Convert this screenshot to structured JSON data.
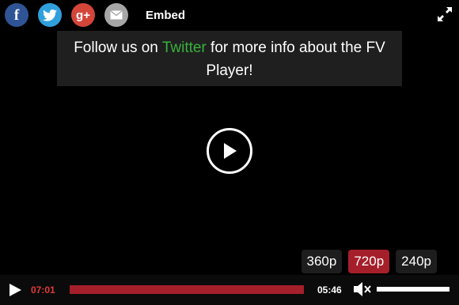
{
  "share": {
    "items": [
      {
        "icon": "facebook-icon",
        "glyph": "f"
      },
      {
        "icon": "twitter-icon",
        "glyph": ""
      },
      {
        "icon": "google-plus-icon",
        "glyph": "g+"
      },
      {
        "icon": "email-icon",
        "glyph": ""
      }
    ],
    "embed_label": "Embed"
  },
  "announcement": {
    "before": "Follow us on ",
    "link_text": "Twitter",
    "after": " for more info about the FV Player!"
  },
  "quality": {
    "options": [
      "360p",
      "720p",
      "240p"
    ],
    "selected": "720p"
  },
  "controls": {
    "elapsed": "07:01",
    "duration": "05:46",
    "progress_fraction": 1.0,
    "volume_fraction": 1.0
  },
  "colors": {
    "accent": "#a51f2b",
    "link": "#38b13b",
    "elapsed_text": "#e23a3a",
    "facebook": "#2f5496",
    "twitter": "#30a0dd",
    "google_plus": "#d4453a",
    "email": "#a6a6a6"
  }
}
